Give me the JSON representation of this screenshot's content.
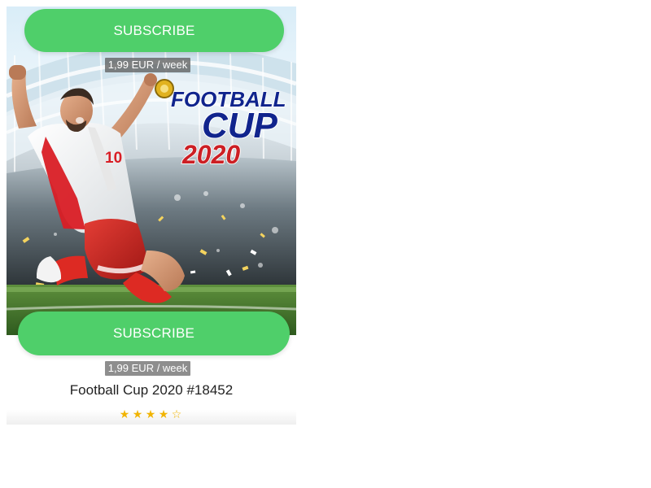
{
  "card": {
    "subscribe_top_label": "SUBSCRIBE",
    "subscribe_bottom_label": "SUBSCRIBE",
    "price_top": "1,99 EUR / week",
    "price_bottom": "1,99 EUR / week",
    "game_title": "Football Cup 2020 #18452",
    "hero": {
      "logo_line1": "FOOTBALL",
      "logo_line2": "CUP",
      "logo_line3": "2020",
      "jersey_number": "10"
    },
    "rating": {
      "filled_stars": 4,
      "total_stars": 5,
      "star_full": "★",
      "star_empty": "☆"
    }
  },
  "colors": {
    "subscribe_green": "#4fcf6a",
    "price_tag_gray": "#8e8e8e",
    "star_gold": "#f1b400",
    "logo_blue": "#10248d",
    "logo_red": "#cc1f24"
  }
}
